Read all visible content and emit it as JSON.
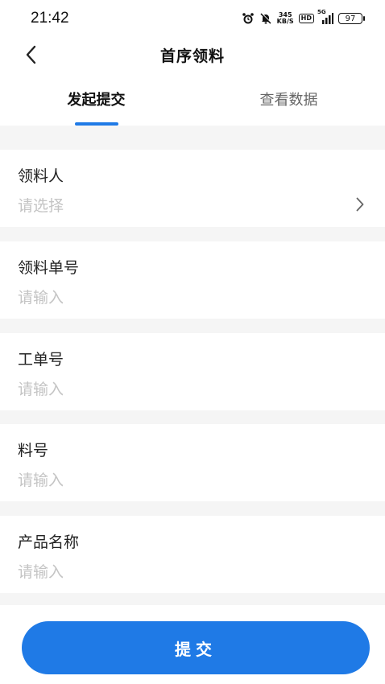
{
  "status_bar": {
    "time": "21:42",
    "net_speed_top": "345",
    "net_speed_bottom": "KB/S",
    "hd_badge": "HD",
    "network": "5G",
    "battery": "97",
    "icons": [
      "alarm-icon",
      "mute-icon",
      "signal-icon",
      "battery-icon"
    ]
  },
  "header": {
    "title": "首序领料",
    "back_icon": "chevron-left-icon"
  },
  "tabs": [
    {
      "label": "发起提交",
      "active": true
    },
    {
      "label": "查看数据",
      "active": false
    }
  ],
  "form": {
    "fields": [
      {
        "label": "领料人",
        "value": "请选择",
        "type": "select"
      },
      {
        "label": "领料单号",
        "value": "请输入",
        "type": "input"
      },
      {
        "label": "工单号",
        "value": "请输入",
        "type": "input"
      },
      {
        "label": "料号",
        "value": "请输入",
        "type": "input"
      },
      {
        "label": "产品名称",
        "value": "请输入",
        "type": "input"
      }
    ]
  },
  "submit": {
    "label": "提交"
  },
  "colors": {
    "accent": "#1f7ae6",
    "background": "#f5f5f5",
    "placeholder": "#c4c4c4"
  }
}
